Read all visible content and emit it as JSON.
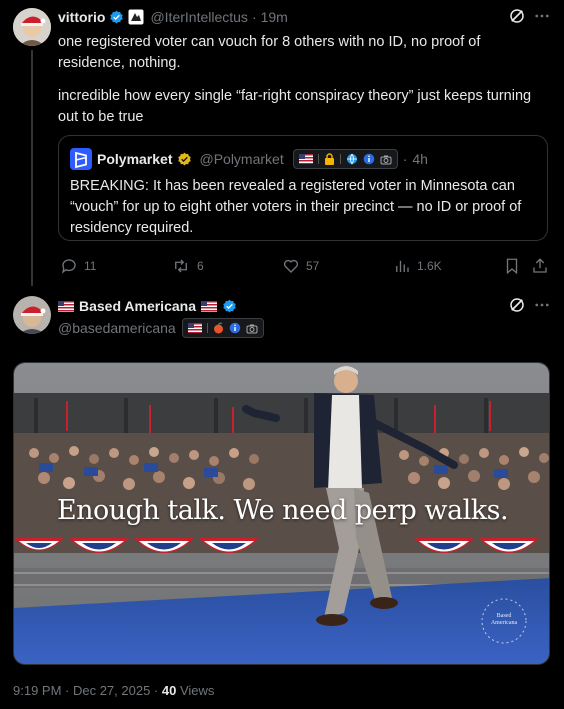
{
  "post1": {
    "display_name": "vittorio",
    "handle": "@IterIntellectus",
    "time": "19m",
    "text_line1": "one registered voter can vouch for 8 others with no ID, no proof of residence, nothing.",
    "text_line2": "incredible how every single “far-right conspiracy theory” just keeps turning out to be true"
  },
  "quote": {
    "display_name": "Polymarket",
    "handle": "@Polymarket",
    "time": "4h",
    "text": "BREAKING: It has been revealed a registered voter in Minnesota can “vouch” for up to eight other voters in their precinct — no ID or proof of residency required."
  },
  "actions": {
    "replies": "11",
    "reposts": "6",
    "likes": "57",
    "views": "1.6K"
  },
  "post2": {
    "display_name": "Based Americana",
    "handle": "@basedamericana",
    "media_caption": "Enough talk. We need perp walks.",
    "watermark": "Based Americana"
  },
  "footer": {
    "timestamp": "9:19 PM · Dec 27, 2025 · ",
    "views_count": "40",
    "views_label": " Views"
  },
  "colors": {
    "verified_blue": "#1d9bf0",
    "verified_gold": "#e2b719",
    "muted": "#71767b"
  }
}
